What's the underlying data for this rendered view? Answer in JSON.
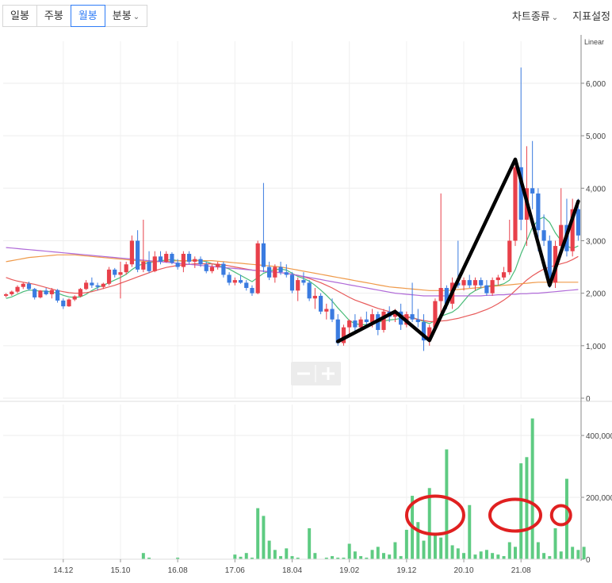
{
  "tabs": [
    {
      "label": "일봉",
      "active": false
    },
    {
      "label": "주봉",
      "active": false
    },
    {
      "label": "월봉",
      "active": true
    },
    {
      "label": "분봉",
      "active": false,
      "dropdown": true
    }
  ],
  "menus": {
    "chart_type": "차트종류",
    "indicator": "지표설정"
  },
  "chart_data": [
    {
      "type": "candlestick",
      "scale_label": "Linear",
      "ylim": [
        0,
        6800
      ],
      "y_ticks": [
        "6,000",
        "5,000",
        "4,000",
        "3,000",
        "2,000",
        "1,000",
        "0"
      ],
      "x_ticks": [
        "14.12",
        "15.10",
        "16.08",
        "17.06",
        "18.04",
        "19.02",
        "19.12",
        "20.10",
        "21.08"
      ],
      "x_tick_index": [
        10,
        20,
        30,
        40,
        50,
        60,
        70,
        80,
        90
      ],
      "colors": {
        "up": "#e8404a",
        "down": "#3a7be0"
      },
      "ohlc": [
        [
          1950,
          2000,
          1920,
          1980
        ],
        [
          1980,
          2050,
          1950,
          2030
        ],
        [
          2030,
          2150,
          2000,
          2120
        ],
        [
          2120,
          2200,
          2080,
          2180
        ],
        [
          2180,
          2220,
          2050,
          2080
        ],
        [
          2080,
          2100,
          1880,
          1920
        ],
        [
          1920,
          2060,
          1900,
          2050
        ],
        [
          2050,
          2100,
          1960,
          1980
        ],
        [
          1980,
          2100,
          1900,
          2060
        ],
        [
          2060,
          2080,
          1820,
          1860
        ],
        [
          1860,
          1900,
          1700,
          1750
        ],
        [
          1750,
          1900,
          1740,
          1880
        ],
        [
          1880,
          1960,
          1850,
          1940
        ],
        [
          1940,
          2100,
          1920,
          2080
        ],
        [
          2080,
          2250,
          2060,
          2200
        ],
        [
          2200,
          2300,
          2100,
          2150
        ],
        [
          2150,
          2200,
          2050,
          2120
        ],
        [
          2120,
          2200,
          2080,
          2180
        ],
        [
          2180,
          2500,
          2150,
          2450
        ],
        [
          2450,
          2480,
          2300,
          2350
        ],
        [
          2350,
          2600,
          1900,
          2400
        ],
        [
          2400,
          2600,
          2350,
          2550
        ],
        [
          2550,
          3100,
          2500,
          3000
        ],
        [
          3000,
          3200,
          2400,
          2450
        ],
        [
          2450,
          3400,
          2400,
          2600
        ],
        [
          2600,
          2800,
          2380,
          2420
        ],
        [
          2420,
          2800,
          2400,
          2700
        ],
        [
          2700,
          2800,
          2550,
          2600
        ],
        [
          2600,
          2800,
          2580,
          2750
        ],
        [
          2750,
          2780,
          2550,
          2580
        ],
        [
          2580,
          2650,
          2450,
          2500
        ],
        [
          2500,
          2800,
          2400,
          2750
        ],
        [
          2750,
          2800,
          2550,
          2600
        ],
        [
          2600,
          2700,
          2480,
          2650
        ],
        [
          2650,
          2700,
          2500,
          2550
        ],
        [
          2550,
          2600,
          2380,
          2420
        ],
        [
          2420,
          2550,
          2380,
          2500
        ],
        [
          2500,
          2600,
          2450,
          2560
        ],
        [
          2560,
          2600,
          2300,
          2350
        ],
        [
          2350,
          2400,
          2150,
          2200
        ],
        [
          2200,
          2300,
          2150,
          2250
        ],
        [
          2250,
          2350,
          2180,
          2200
        ],
        [
          2200,
          2250,
          2050,
          2100
        ],
        [
          2100,
          2150,
          1950,
          2000
        ],
        [
          2000,
          3000,
          1980,
          2950
        ],
        [
          2950,
          4100,
          2400,
          2500
        ],
        [
          2500,
          2600,
          2250,
          2300
        ],
        [
          2300,
          2550,
          2200,
          2500
        ],
        [
          2500,
          2600,
          2350,
          2400
        ],
        [
          2400,
          2550,
          2300,
          2350
        ],
        [
          2350,
          2400,
          2000,
          2050
        ],
        [
          2050,
          2300,
          1850,
          2250
        ],
        [
          2250,
          2400,
          2150,
          2200
        ],
        [
          2200,
          2250,
          1850,
          1900
        ],
        [
          1900,
          2100,
          1700,
          1950
        ],
        [
          1950,
          2000,
          1600,
          1650
        ],
        [
          1650,
          1800,
          1500,
          1700
        ],
        [
          1700,
          1900,
          1450,
          1500
        ],
        [
          1500,
          1600,
          1000,
          1050
        ],
        [
          1050,
          1400,
          1000,
          1350
        ],
        [
          1350,
          1500,
          1200,
          1480
        ],
        [
          1480,
          1600,
          1250,
          1350
        ],
        [
          1350,
          1550,
          1300,
          1500
        ],
        [
          1500,
          1650,
          1350,
          1450
        ],
        [
          1450,
          1700,
          1350,
          1600
        ],
        [
          1600,
          1650,
          1200,
          1300
        ],
        [
          1300,
          1700,
          1250,
          1650
        ],
        [
          1650,
          1750,
          1450,
          1550
        ],
        [
          1550,
          1700,
          1450,
          1650
        ],
        [
          1650,
          1800,
          1300,
          1400
        ],
        [
          1400,
          1650,
          1350,
          1600
        ],
        [
          1600,
          2200,
          1450,
          1500
        ],
        [
          1500,
          1700,
          1350,
          1450
        ],
        [
          1450,
          1600,
          900,
          1100
        ],
        [
          1100,
          1400,
          1000,
          1350
        ],
        [
          1350,
          1900,
          1300,
          1850
        ],
        [
          1850,
          3900,
          1600,
          2100
        ],
        [
          2100,
          2150,
          1700,
          1800
        ],
        [
          1800,
          2300,
          1700,
          2200
        ],
        [
          2200,
          3000,
          2100,
          2150
        ],
        [
          2150,
          2300,
          2050,
          2250
        ],
        [
          2250,
          2350,
          2100,
          2150
        ],
        [
          2150,
          2300,
          2050,
          2250
        ],
        [
          2250,
          2300,
          2100,
          2150
        ],
        [
          2150,
          2250,
          1950,
          2000
        ],
        [
          2000,
          2300,
          1950,
          2250
        ],
        [
          2250,
          2350,
          2150,
          2300
        ],
        [
          2300,
          2500,
          2250,
          2400
        ],
        [
          2400,
          3400,
          2350,
          3000
        ],
        [
          3000,
          4500,
          2900,
          4400
        ],
        [
          4400,
          6300,
          3200,
          3400
        ],
        [
          3400,
          4800,
          2900,
          4000
        ],
        [
          4000,
          4900,
          3600,
          3900
        ],
        [
          3900,
          4000,
          2800,
          3200
        ],
        [
          3200,
          3500,
          2900,
          3000
        ],
        [
          3000,
          3100,
          2100,
          2200
        ],
        [
          2200,
          3000,
          2100,
          2900
        ],
        [
          2900,
          4000,
          2700,
          3300
        ],
        [
          3300,
          3800,
          2700,
          2800
        ],
        [
          2800,
          3800,
          2700,
          3600
        ],
        [
          3600,
          3800,
          3000,
          3100
        ]
      ],
      "moving_averages": [
        {
          "color": "#48bb78",
          "values": [
            1900,
            1930,
            1980,
            2030,
            2060,
            2050,
            2040,
            2040,
            2020,
            2000,
            1960,
            1930,
            1920,
            1930,
            1980,
            2050,
            2110,
            2150,
            2200,
            2250,
            2300,
            2360,
            2450,
            2520,
            2560,
            2580,
            2600,
            2620,
            2630,
            2640,
            2620,
            2610,
            2620,
            2630,
            2620,
            2600,
            2560,
            2530,
            2500,
            2460,
            2400,
            2340,
            2280,
            2220,
            2300,
            2380,
            2420,
            2450,
            2460,
            2440,
            2380,
            2320,
            2280,
            2230,
            2150,
            2060,
            1960,
            1850,
            1720,
            1600,
            1480,
            1420,
            1400,
            1400,
            1430,
            1450,
            1470,
            1490,
            1500,
            1520,
            1530,
            1540,
            1500,
            1460,
            1420,
            1480,
            1560,
            1600,
            1640,
            1720,
            1850,
            1980,
            2050,
            2100,
            2130,
            2150,
            2150,
            2180,
            2250,
            2450,
            2750,
            3000,
            3250,
            3400,
            3450,
            3350,
            3150,
            3000,
            2900,
            2850,
            2900
          ]
        },
        {
          "color": "#e85a5a",
          "values": [
            2300,
            2260,
            2230,
            2210,
            2190,
            2170,
            2140,
            2110,
            2080,
            2050,
            2030,
            2010,
            2000,
            2000,
            2010,
            2030,
            2060,
            2090,
            2120,
            2150,
            2190,
            2230,
            2270,
            2310,
            2350,
            2390,
            2430,
            2460,
            2490,
            2510,
            2530,
            2540,
            2550,
            2560,
            2560,
            2560,
            2560,
            2550,
            2540,
            2520,
            2500,
            2480,
            2460,
            2440,
            2430,
            2420,
            2410,
            2400,
            2390,
            2380,
            2360,
            2340,
            2310,
            2280,
            2240,
            2200,
            2150,
            2100,
            2040,
            1980,
            1920,
            1870,
            1830,
            1790,
            1750,
            1710,
            1680,
            1650,
            1620,
            1590,
            1560,
            1530,
            1500,
            1480,
            1460,
            1460,
            1470,
            1480,
            1500,
            1520,
            1550,
            1580,
            1610,
            1650,
            1690,
            1740,
            1800,
            1870,
            1950,
            2050,
            2150,
            2250,
            2330,
            2400,
            2460,
            2500,
            2530,
            2560,
            2590,
            2640,
            2700
          ]
        },
        {
          "color": "#ef9a4a",
          "values": [
            2600,
            2620,
            2640,
            2660,
            2680,
            2690,
            2700,
            2710,
            2720,
            2730,
            2730,
            2730,
            2730,
            2720,
            2710,
            2700,
            2690,
            2680,
            2670,
            2660,
            2650,
            2640,
            2630,
            2620,
            2610,
            2600,
            2600,
            2600,
            2600,
            2610,
            2620,
            2620,
            2620,
            2620,
            2620,
            2620,
            2620,
            2610,
            2600,
            2590,
            2580,
            2570,
            2560,
            2550,
            2540,
            2530,
            2520,
            2510,
            2500,
            2480,
            2460,
            2440,
            2420,
            2400,
            2380,
            2360,
            2340,
            2320,
            2300,
            2280,
            2260,
            2240,
            2220,
            2200,
            2180,
            2160,
            2140,
            2120,
            2110,
            2100,
            2090,
            2080,
            2070,
            2060,
            2050,
            2050,
            2050,
            2050,
            2060,
            2070,
            2080,
            2090,
            2100,
            2110,
            2120,
            2130,
            2140,
            2150,
            2160,
            2170,
            2180,
            2190,
            2200,
            2210,
            2210,
            2210,
            2210,
            2210,
            2210,
            2210,
            2210
          ]
        },
        {
          "color": "#b06ad8",
          "values": [
            2870,
            2860,
            2850,
            2840,
            2830,
            2820,
            2810,
            2800,
            2790,
            2780,
            2770,
            2760,
            2750,
            2740,
            2730,
            2720,
            2710,
            2700,
            2690,
            2680,
            2670,
            2660,
            2650,
            2640,
            2630,
            2620,
            2610,
            2600,
            2590,
            2580,
            2570,
            2560,
            2550,
            2540,
            2530,
            2520,
            2510,
            2500,
            2490,
            2480,
            2470,
            2460,
            2450,
            2440,
            2430,
            2420,
            2410,
            2400,
            2390,
            2380,
            2360,
            2340,
            2320,
            2300,
            2280,
            2260,
            2240,
            2220,
            2200,
            2180,
            2160,
            2140,
            2120,
            2100,
            2080,
            2060,
            2040,
            2020,
            2000,
            1990,
            1980,
            1970,
            1960,
            1950,
            1950,
            1950,
            1950,
            1950,
            1950,
            1950,
            1950,
            1950,
            1950,
            1950,
            1960,
            1960,
            1970,
            1970,
            1980,
            1980,
            1990,
            1990,
            2000,
            2000,
            2010,
            2020,
            2030,
            2040,
            2050,
            2060,
            2070
          ]
        }
      ],
      "trend_line": [
        [
          58,
          1080
        ],
        [
          68,
          1650
        ],
        [
          74,
          1100
        ],
        [
          89,
          4550
        ],
        [
          95,
          2150
        ],
        [
          100,
          3750
        ]
      ]
    },
    {
      "type": "bar",
      "ylim": [
        0,
        500000
      ],
      "y_ticks": [
        "400,000",
        "200,000",
        "0"
      ],
      "color": "#5ecb82",
      "values": [
        0,
        0,
        0,
        0,
        0,
        0,
        0,
        0,
        0,
        0,
        0,
        0,
        0,
        0,
        0,
        0,
        0,
        0,
        0,
        0,
        0,
        0,
        0,
        0,
        20000,
        5000,
        0,
        0,
        0,
        0,
        5000,
        0,
        0,
        0,
        0,
        0,
        0,
        0,
        0,
        0,
        15000,
        8000,
        20000,
        5000,
        165000,
        140000,
        60000,
        30000,
        10000,
        35000,
        10000,
        5000,
        0,
        100000,
        20000,
        0,
        5000,
        10000,
        5000,
        5000,
        50000,
        25000,
        10000,
        5000,
        30000,
        40000,
        20000,
        15000,
        55000,
        10000,
        95000,
        205000,
        120000,
        60000,
        230000,
        80000,
        70000,
        355000,
        45000,
        35000,
        20000,
        175000,
        15000,
        25000,
        30000,
        20000,
        15000,
        10000,
        55000,
        40000,
        310000,
        330000,
        455000,
        55000,
        20000,
        10000,
        100000,
        25000,
        260000,
        40000,
        30000,
        40000
      ],
      "highlight_circles": [
        [
          75,
          150000
        ],
        [
          89,
          150000
        ],
        [
          97,
          150000
        ]
      ],
      "highlight_color": "#e02020"
    }
  ]
}
